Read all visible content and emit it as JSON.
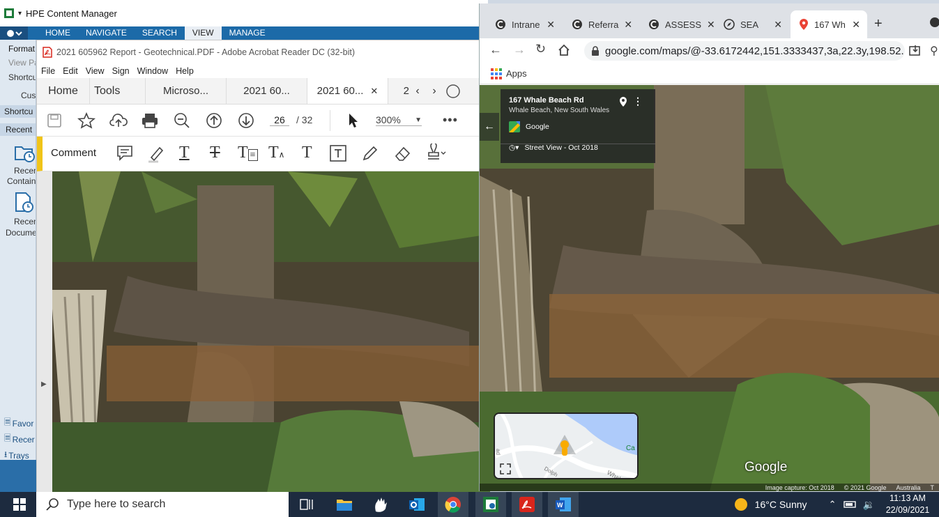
{
  "hpe": {
    "title": "HPE Content Manager",
    "ribbon_tabs": [
      "HOME",
      "NAVIGATE",
      "SEARCH",
      "VIEW",
      "MANAGE"
    ],
    "active_tab": "VIEW",
    "sidebar": {
      "format": "Format",
      "view_pane": "View Pa",
      "shortcuts": "Shortcu",
      "customize": "Cus",
      "shortcuts_head": "Shortcu",
      "recent_head": "Recent",
      "recent_containers": [
        "Recen",
        "Contain"
      ],
      "recent_documents": [
        "Recen",
        "Docume"
      ],
      "favorites": "Favor",
      "recent_link": "Recer",
      "trays": "Trays"
    }
  },
  "acrobat": {
    "title": "2021 605962  Report - Geotechnical.PDF - Adobe Acrobat Reader DC (32-bit)",
    "menu": [
      "File",
      "Edit",
      "View",
      "Sign",
      "Window",
      "Help"
    ],
    "tabs": [
      "Home",
      "Tools",
      "Microso...",
      "2021 60...",
      "2021 60...",
      "2"
    ],
    "active_tab_index": 4,
    "page_current": "26",
    "page_total": "/ 32",
    "zoom": "300%",
    "comment_label": "Comment"
  },
  "chrome": {
    "tabs": [
      {
        "label": "Intrane",
        "icon": "intranet-icon"
      },
      {
        "label": "Referra",
        "icon": "referral-icon"
      },
      {
        "label": "ASSESS",
        "icon": "assess-icon"
      },
      {
        "label": "SEA",
        "icon": "sea-icon"
      },
      {
        "label": "167 Wh",
        "icon": "maps-pin-icon"
      }
    ],
    "url": "google.com/maps/@-33.6172442,151.3333437,3a,22.3y,198.52...",
    "bookmarks_apps": "Apps",
    "streetview": {
      "place": "167 Whale Beach Rd",
      "locality": "Whale Beach, New South Wales",
      "provider": "Google",
      "date": "Street View - Oct 2018",
      "watermark": "Google",
      "footer": [
        "Image capture: Oct 2018",
        "© 2021 Google",
        "Australia",
        "T"
      ],
      "map_labels": [
        "Ca",
        "Whal",
        "Dolph",
        "ad"
      ]
    }
  },
  "taskbar": {
    "search_placeholder": "Type here to search",
    "weather": "16°C  Sunny",
    "time": "11:13 AM",
    "date": "22/09/2021"
  },
  "colors": {
    "hpe_ribbon": "#1c6aa8",
    "acrobat_red": "#d9261c",
    "comment_bar": "#f0c419",
    "taskbar": "#1d2b3f"
  }
}
